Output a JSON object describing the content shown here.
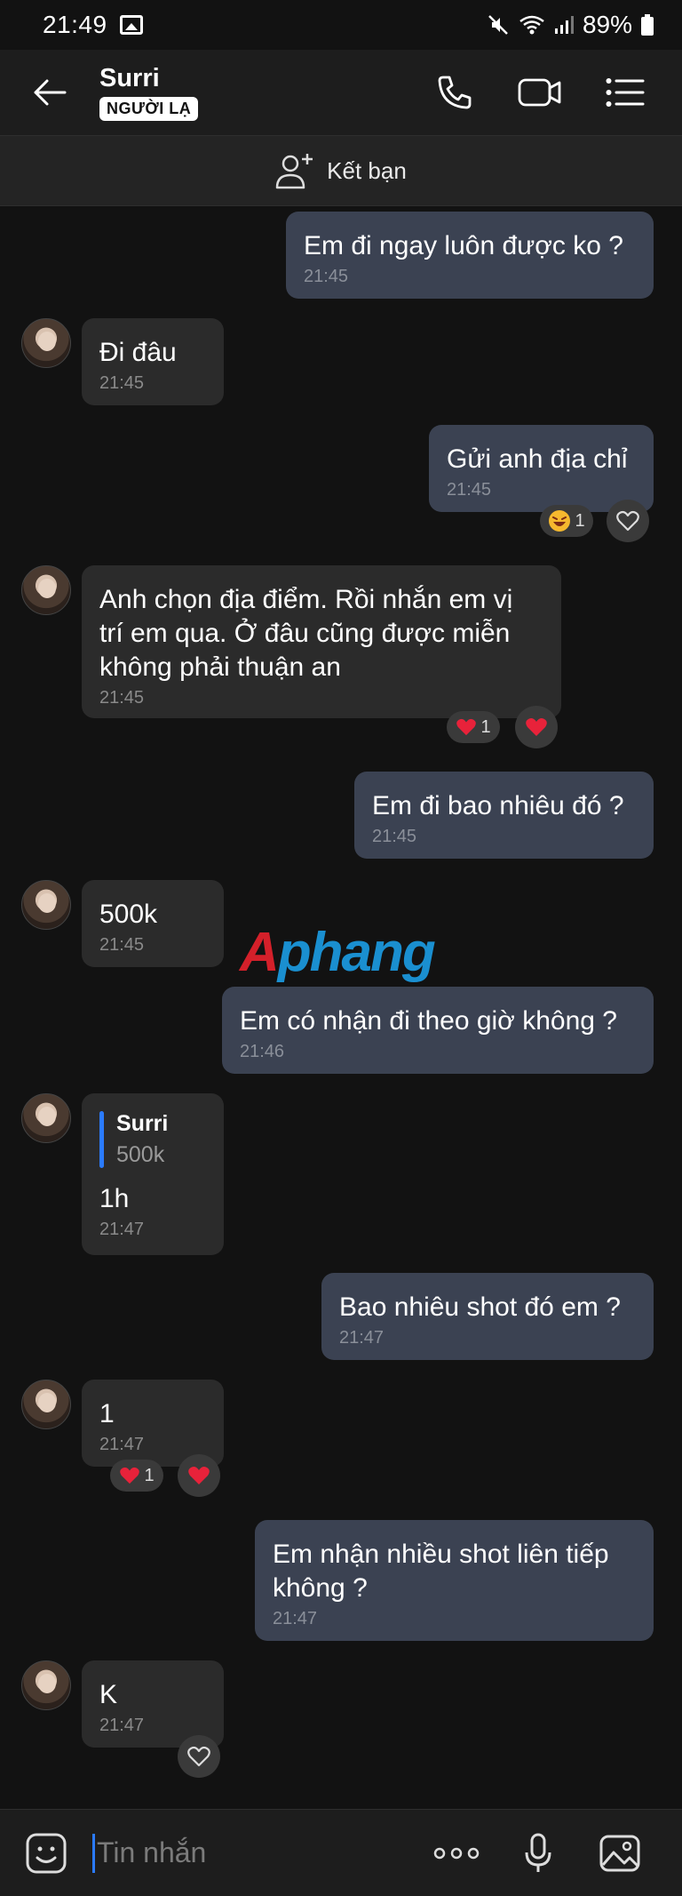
{
  "status_bar": {
    "time": "21:49",
    "battery": "89%"
  },
  "header": {
    "name": "Surri",
    "badge": "NGƯỜI LẠ"
  },
  "add_friend": {
    "label": "Kết bạn"
  },
  "messages": [
    {
      "dir": "out",
      "text": "Em đi ngay luôn được ko ?",
      "time": "21:45"
    },
    {
      "dir": "in",
      "text": "Đi đâu",
      "time": "21:45"
    },
    {
      "dir": "out",
      "text": "Gửi anh địa chỉ",
      "time": "21:45",
      "reaction": {
        "emoji": "laugh-emoji",
        "count": "1"
      }
    },
    {
      "dir": "in",
      "text": "Anh chọn địa điểm. Rồi nhắn em vị trí em qua. Ở đâu cũng được miễn không phải thuận an",
      "time": "21:45",
      "reaction": {
        "emoji": "heart-emoji",
        "count": "1"
      }
    },
    {
      "dir": "out",
      "text": "Em đi bao nhiêu đó ?",
      "time": "21:45"
    },
    {
      "dir": "in",
      "text": "500k",
      "time": "21:45"
    },
    {
      "dir": "out",
      "text": "Em có nhận đi theo giờ không ?",
      "time": "21:46"
    },
    {
      "dir": "in",
      "quote": {
        "name": "Surri",
        "text": "500k"
      },
      "text": "1h",
      "time": "21:47"
    },
    {
      "dir": "out",
      "text": "Bao nhiêu shot đó em ?",
      "time": "21:47"
    },
    {
      "dir": "in",
      "text": "1",
      "time": "21:47",
      "reaction": {
        "emoji": "heart-emoji",
        "count": "1"
      }
    },
    {
      "dir": "out",
      "text": "Em nhận nhiều shot liên tiếp không ?",
      "time": "21:47"
    },
    {
      "dir": "in",
      "text": "K",
      "time": "21:47"
    }
  ],
  "watermark": {
    "first": "A",
    "rest": "phang"
  },
  "composer": {
    "placeholder": "Tin nhắn"
  },
  "colors": {
    "accent": "#2b7bff",
    "out_bubble": "#3b4252",
    "in_bubble": "#2b2b2b",
    "background": "#121212"
  }
}
